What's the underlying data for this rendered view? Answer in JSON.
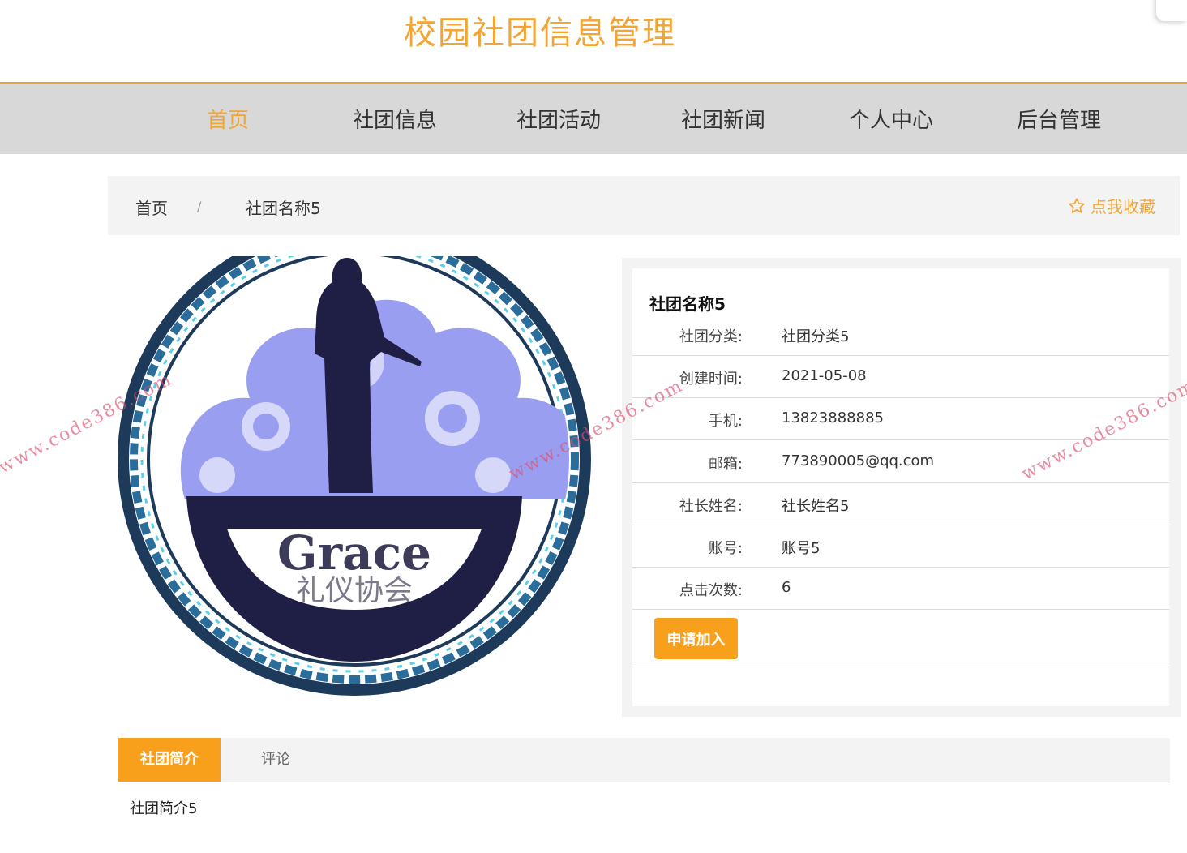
{
  "header": {
    "site_title": "校园社团信息管理"
  },
  "nav": {
    "items": [
      {
        "label": "首页",
        "active": true
      },
      {
        "label": "社团信息"
      },
      {
        "label": "社团活动"
      },
      {
        "label": "社团新闻"
      },
      {
        "label": "个人中心"
      },
      {
        "label": "后台管理"
      }
    ]
  },
  "breadcrumb": {
    "home": "首页",
    "separator": "/",
    "current": "社团名称5"
  },
  "favorite": {
    "label": "点我收藏",
    "icon": "star-outline-icon"
  },
  "logo": {
    "latin_text": "Grace",
    "cn_text": "礼仪协会"
  },
  "club": {
    "name": "社团名称5",
    "fields": [
      {
        "label": "社团分类:",
        "value": "社团分类5"
      },
      {
        "label": "创建时间:",
        "value": "2021-05-08"
      },
      {
        "label": "手机:",
        "value": "13823888885"
      },
      {
        "label": "邮箱:",
        "value": "773890005@qq.com"
      },
      {
        "label": "社长姓名:",
        "value": "社长姓名5"
      },
      {
        "label": "账号:",
        "value": "账号5"
      },
      {
        "label": "点击次数:",
        "value": "6"
      }
    ],
    "join_label": "申请加入"
  },
  "tabs": [
    {
      "label": "社团简介",
      "active": true
    },
    {
      "label": "评论"
    }
  ],
  "intro": {
    "text": "社团简介5"
  },
  "watermark": {
    "text": "www.code386.com"
  },
  "colors": {
    "accent": "#f3a533",
    "button": "#f8a01b",
    "nav_bg": "#d8d8d8"
  }
}
